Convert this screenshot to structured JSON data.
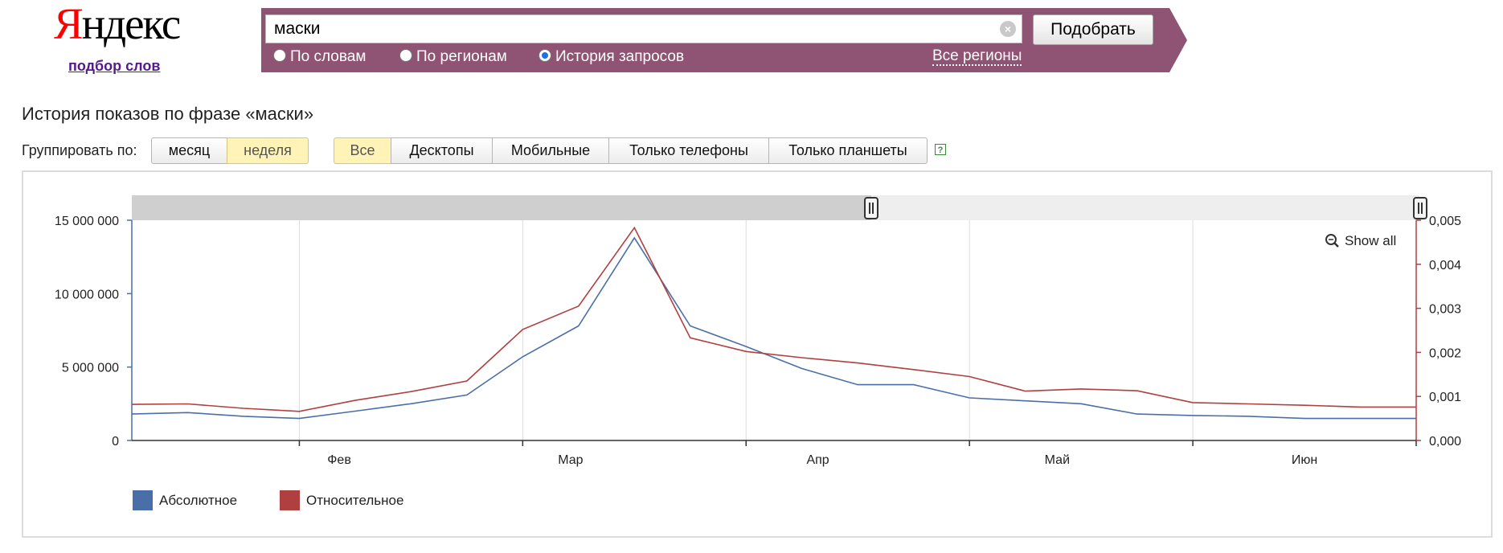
{
  "logo": {
    "text_first": "Я",
    "text_rest": "ндекс",
    "subtitle": "подбор слов"
  },
  "search": {
    "query": "маски",
    "button_label": "Подобрать",
    "modes": [
      {
        "label": "По словам",
        "selected": false
      },
      {
        "label": "По регионам",
        "selected": false
      },
      {
        "label": "История запросов",
        "selected": true
      }
    ],
    "regions_link": "Все регионы"
  },
  "page": {
    "title": "История показов по фразе «маски»"
  },
  "grouping": {
    "label": "Группировать по:",
    "options": [
      {
        "label": "месяц",
        "active": false
      },
      {
        "label": "неделя",
        "active": true
      }
    ]
  },
  "devices": {
    "options": [
      {
        "label": "Все",
        "active": true
      },
      {
        "label": "Десктопы",
        "active": false
      },
      {
        "label": "Мобильные",
        "active": false
      },
      {
        "label": "Только телефоны",
        "active": false
      },
      {
        "label": "Только планшеты",
        "active": false
      }
    ],
    "help": "?"
  },
  "chart_data": {
    "type": "line",
    "show_all_label": "Show all",
    "x_ticks": [
      "Фев",
      "Мар",
      "Апр",
      "Май",
      "Июн"
    ],
    "y_left": {
      "ticks": [
        "0",
        "5 000 000",
        "10 000 000",
        "15 000 000"
      ],
      "range": [
        0,
        15000000
      ]
    },
    "y_right": {
      "ticks": [
        "0,000",
        "0,001",
        "0,002",
        "0,003",
        "0,004",
        "0,005"
      ],
      "range": [
        0,
        0.005
      ]
    },
    "x": [
      "2020-01-20",
      "2020-01-27",
      "2020-02-03",
      "2020-02-10",
      "2020-02-17",
      "2020-02-24",
      "2020-03-02",
      "2020-03-09",
      "2020-03-16",
      "2020-03-23",
      "2020-03-30",
      "2020-04-06",
      "2020-04-13",
      "2020-04-20",
      "2020-04-27",
      "2020-05-04",
      "2020-05-11",
      "2020-05-18",
      "2020-05-25",
      "2020-06-01",
      "2020-06-08",
      "2020-06-15",
      "2020-06-22",
      "2020-06-29"
    ],
    "series": [
      {
        "name": "Абсолютное",
        "axis": "left",
        "color": "#4a6fa8",
        "values": [
          1800000,
          1900000,
          1650000,
          1500000,
          2000000,
          2500000,
          3100000,
          5700000,
          7800000,
          13800000,
          7800000,
          6400000,
          4900000,
          3800000,
          3800000,
          2900000,
          2700000,
          2500000,
          1800000,
          1700000,
          1650000,
          1500000,
          1500000,
          1500000
        ]
      },
      {
        "name": "Относительное",
        "axis": "right",
        "color": "#b0403f",
        "values": [
          0.00082,
          0.00083,
          0.00073,
          0.00066,
          0.00091,
          0.00111,
          0.00135,
          0.00252,
          0.00305,
          0.00483,
          0.00233,
          0.00202,
          0.00188,
          0.00176,
          0.00161,
          0.00145,
          0.00112,
          0.00117,
          0.00113,
          0.00086,
          0.00083,
          0.0008,
          0.00076,
          0.00076
        ]
      }
    ],
    "legend_position": "bottom-left",
    "grid": "vertical"
  }
}
